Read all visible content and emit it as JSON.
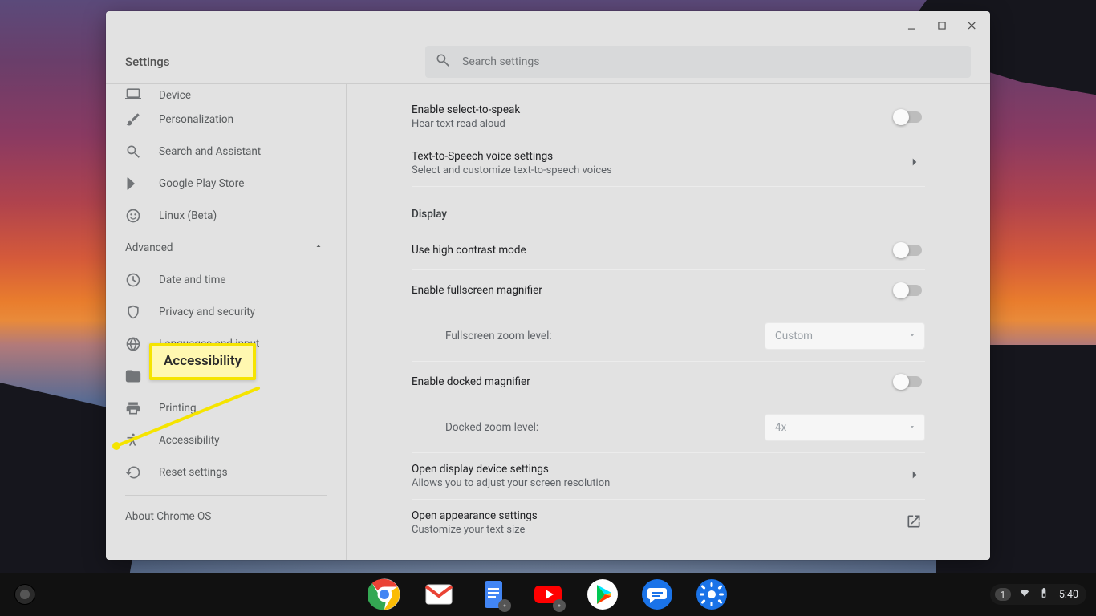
{
  "window": {
    "title": "Settings",
    "search_placeholder": "Search settings"
  },
  "sidebar": {
    "items": [
      {
        "id": "device",
        "label": "Device"
      },
      {
        "id": "personalization",
        "label": "Personalization"
      },
      {
        "id": "search",
        "label": "Search and Assistant"
      },
      {
        "id": "play",
        "label": "Google Play Store"
      },
      {
        "id": "linux",
        "label": "Linux (Beta)"
      }
    ],
    "advanced_label": "Advanced",
    "advanced_items": [
      {
        "id": "datetime",
        "label": "Date and time"
      },
      {
        "id": "privacy",
        "label": "Privacy and security"
      },
      {
        "id": "languages",
        "label": "Languages and input"
      },
      {
        "id": "files",
        "label": "Files"
      },
      {
        "id": "printing",
        "label": "Printing"
      },
      {
        "id": "a11y",
        "label": "Accessibility"
      },
      {
        "id": "reset",
        "label": "Reset settings"
      }
    ],
    "about_label": "About Chrome OS"
  },
  "callout_label": "Accessibility",
  "main": {
    "select_to_speak": {
      "title": "Enable select-to-speak",
      "sub": "Hear text read aloud"
    },
    "tts": {
      "title": "Text-to-Speech voice settings",
      "sub": "Select and customize text-to-speech voices"
    },
    "display_header": "Display",
    "high_contrast": {
      "title": "Use high contrast mode"
    },
    "fullscreen_mag": {
      "title": "Enable fullscreen magnifier"
    },
    "fullscreen_zoom": {
      "label": "Fullscreen zoom level:",
      "value": "Custom"
    },
    "docked_mag": {
      "title": "Enable docked magnifier"
    },
    "docked_zoom": {
      "label": "Docked zoom level:",
      "value": "4x"
    },
    "display_settings": {
      "title": "Open display device settings",
      "sub": "Allows you to adjust your screen resolution"
    },
    "appearance": {
      "title": "Open appearance settings",
      "sub": "Customize your text size"
    }
  },
  "tray": {
    "notif_count": "1",
    "clock": "5:40"
  }
}
